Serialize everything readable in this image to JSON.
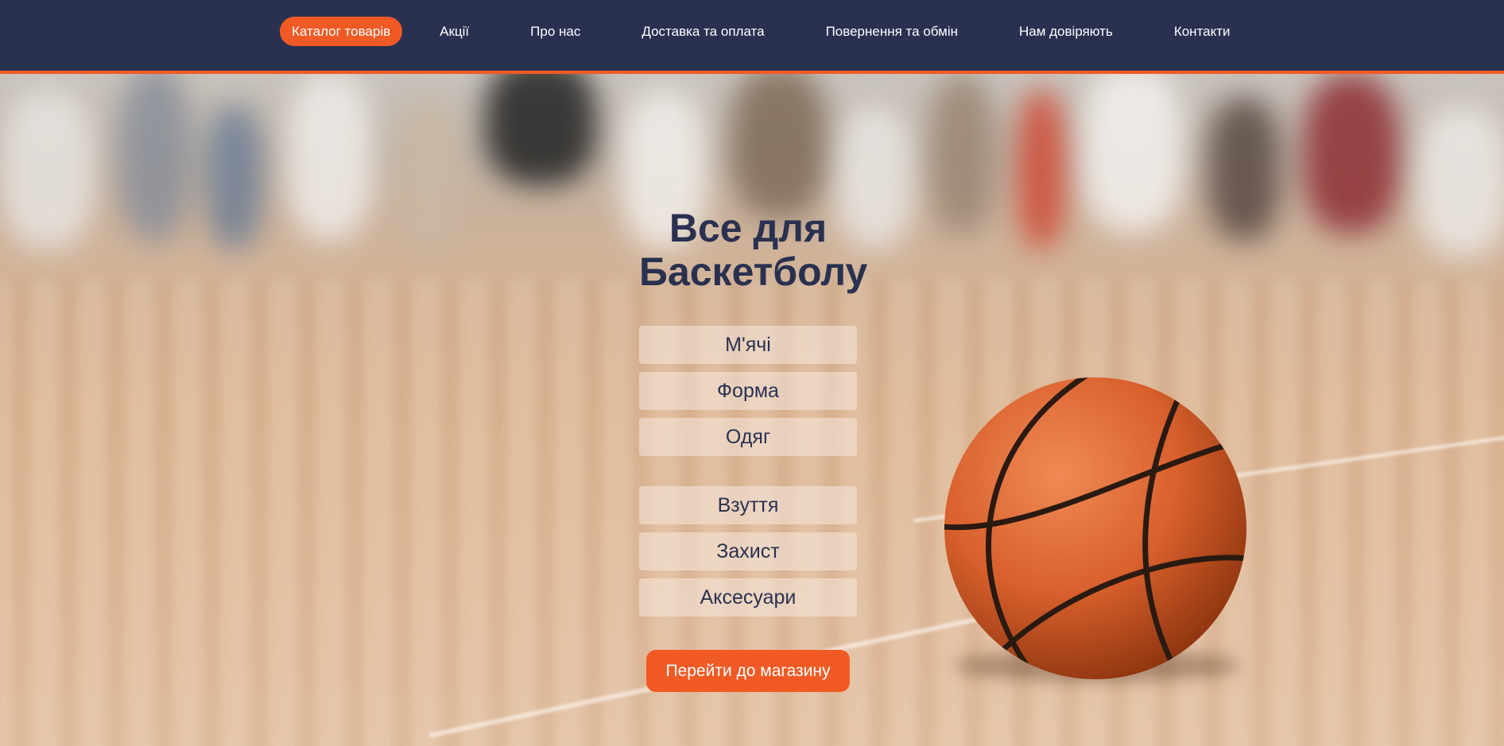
{
  "nav": {
    "items": [
      {
        "label": "Каталог товарів",
        "active": true
      },
      {
        "label": "Акції",
        "active": false
      },
      {
        "label": "Про нас",
        "active": false
      },
      {
        "label": "Доставка та оплата",
        "active": false
      },
      {
        "label": "Повернення та обмін",
        "active": false
      },
      {
        "label": "Нам довіряють",
        "active": false
      },
      {
        "label": "Контакти",
        "active": false
      }
    ]
  },
  "hero": {
    "title": "Все для\nБаскетболу",
    "categories": [
      "М'ячі",
      "Форма",
      "Одяг",
      "Взуття",
      "Захист",
      "Аксесуари"
    ],
    "cta_label": "Перейти до магазину",
    "image": "basketball-on-court"
  },
  "colors": {
    "navbar": "#2a3150",
    "accent": "#f15a24",
    "title": "#2a3150"
  }
}
